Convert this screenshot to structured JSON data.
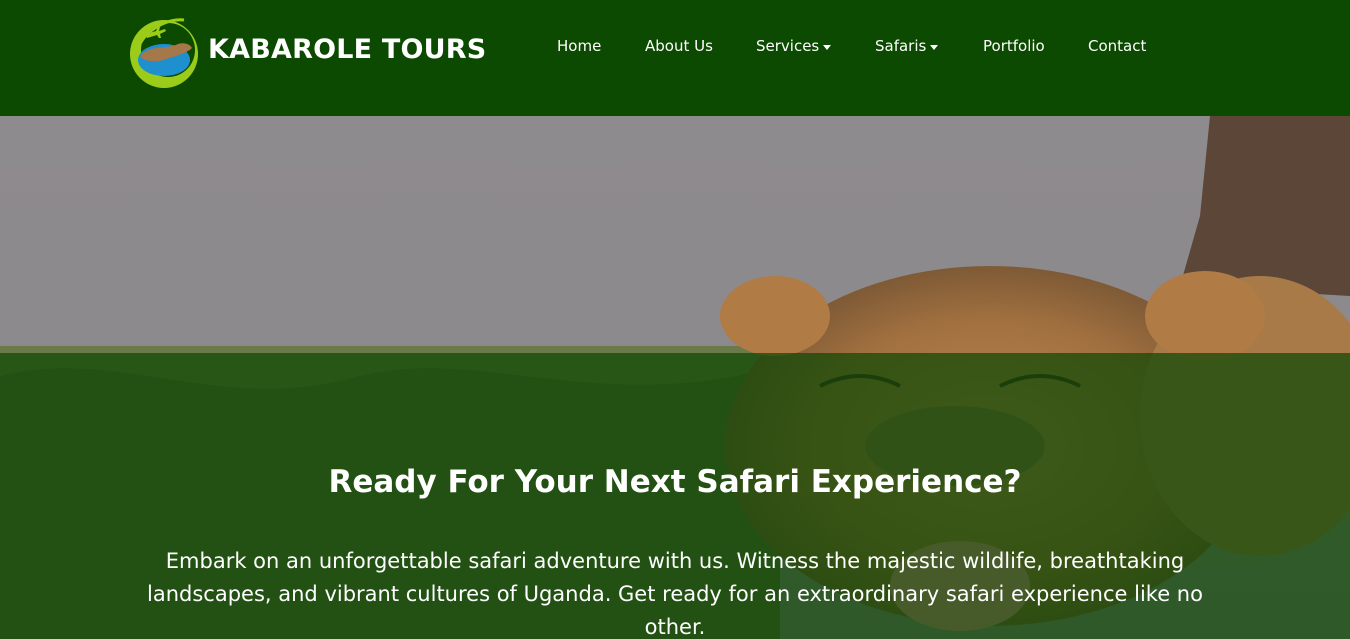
{
  "brand": {
    "name": "KABAROLE TOURS",
    "logo_icon": "airplane-globe-logo-icon"
  },
  "nav": {
    "home": "Home",
    "about": "About Us",
    "services": "Services",
    "safaris": "Safaris",
    "portfolio": "Portfolio",
    "contact": "Contact"
  },
  "hero": {
    "title": "Ready For Your Next Safari Experience?",
    "text": "Embark on an unforgettable safari adventure with us. Witness the majestic wildlife, breathtaking landscapes, and vibrant cultures of Uganda. Get ready for an extraordinary safari experience like no other."
  },
  "colors": {
    "navbar": "#0b4a00",
    "overlay": "#0e4804",
    "logo_green": "#9ccc1a",
    "logo_blue": "#1e8fcf"
  }
}
